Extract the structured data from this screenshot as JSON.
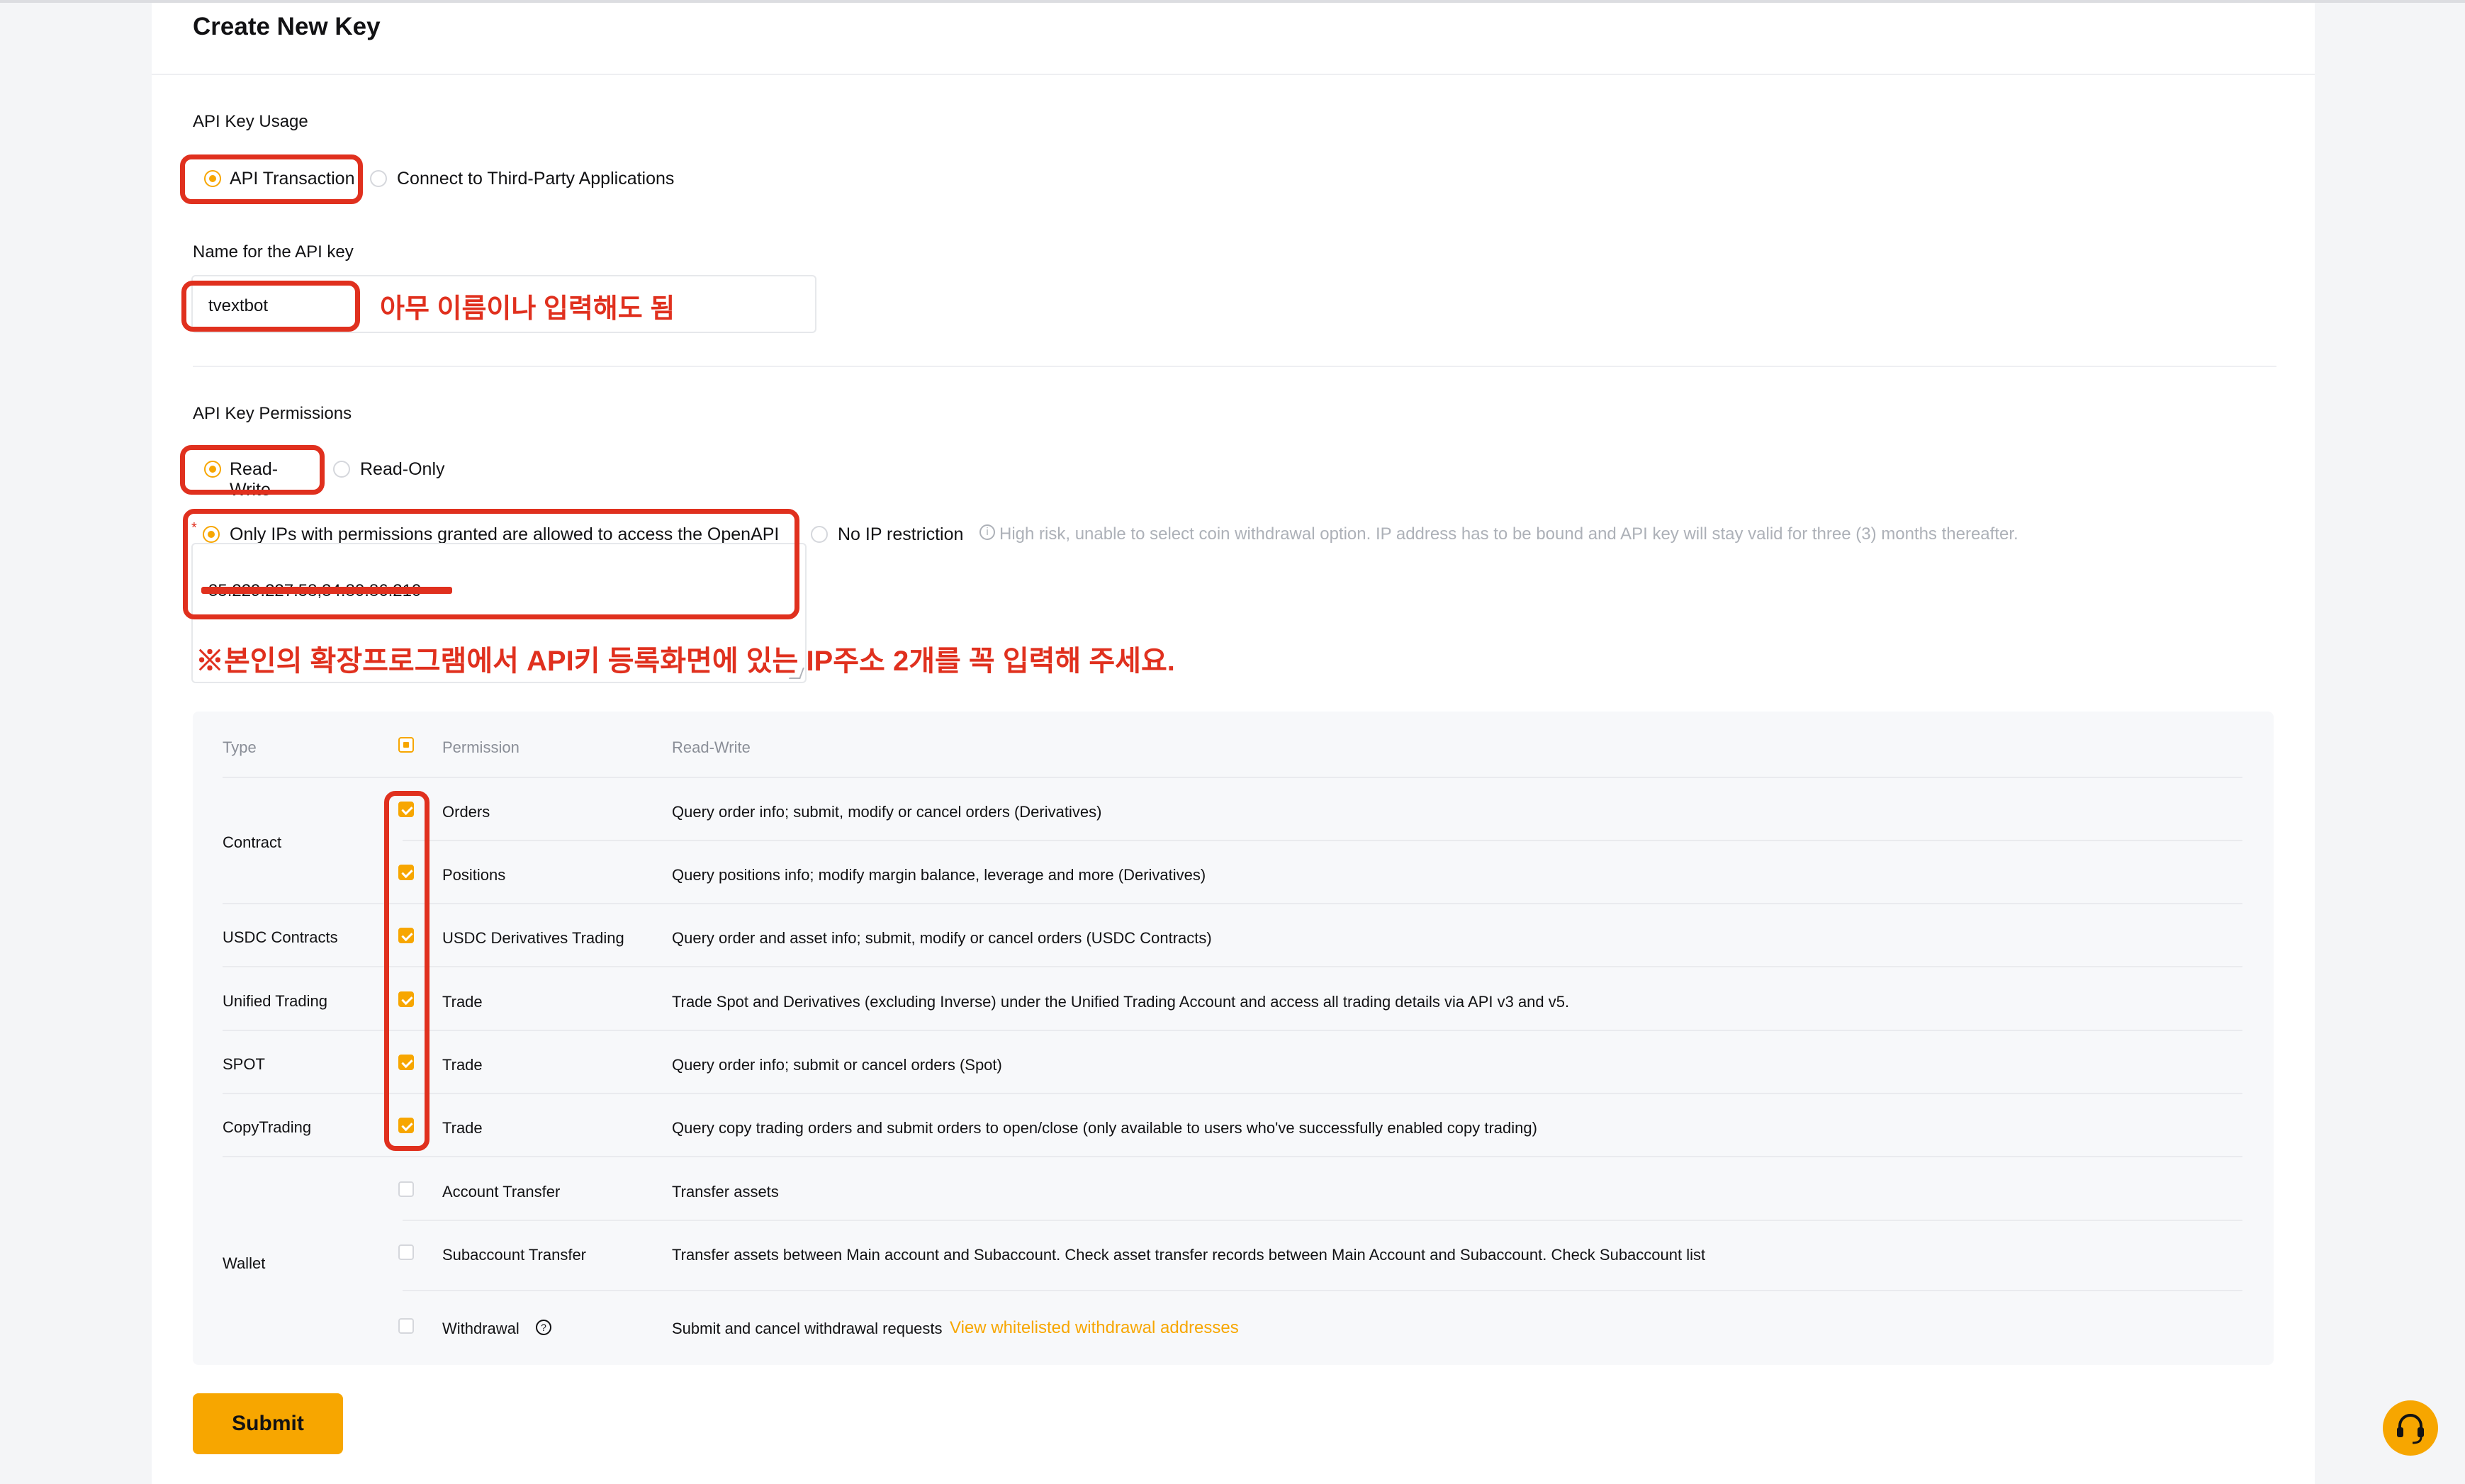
{
  "page": {
    "title": "Create New Key"
  },
  "usage": {
    "label": "API Key Usage",
    "options": [
      "API Transaction",
      "Connect to Third-Party Applications"
    ],
    "selected": "API Transaction"
  },
  "name_field": {
    "label": "Name for the API key",
    "value": "tvextbot"
  },
  "permissions": {
    "label": "API Key Permissions",
    "options": [
      "Read-Write",
      "Read-Only"
    ],
    "selected": "Read-Write"
  },
  "ip": {
    "option_restricted": "Only IPs with permissions granted are allowed to access the OpenAPI",
    "option_unrestricted": "No IP restriction",
    "warning": "High risk, unable to select coin withdrawal option. IP address has to be bound and API key will stay valid for three (3) months thereafter.",
    "value": "35.229.227.58,34.80.86.210",
    "selected": "restricted"
  },
  "annotations": {
    "name_note": "아무 이름이나 입력해도 됨",
    "ip_note": "※본인의 확장프로그램에서 API키 등록화면에 있는 IP주소 2개를 꼭 입력해 주세요."
  },
  "table": {
    "headers": {
      "type": "Type",
      "permission": "Permission",
      "access": "Read-Write"
    },
    "groups": [
      "Contract",
      "USDC Contracts",
      "Unified Trading",
      "SPOT",
      "CopyTrading",
      "Wallet"
    ],
    "rows": [
      {
        "permission": "Orders",
        "description": "Query order info; submit, modify or cancel orders (Derivatives)",
        "checked": true
      },
      {
        "permission": "Positions",
        "description": "Query positions info; modify margin balance, leverage and more (Derivatives)",
        "checked": true
      },
      {
        "permission": "USDC Derivatives Trading",
        "description": "Query order and asset info; submit, modify or cancel orders (USDC Contracts)",
        "checked": true
      },
      {
        "permission": "Trade",
        "description": "Trade Spot and Derivatives (excluding Inverse) under the Unified Trading Account and access all trading details via API v3 and v5.",
        "checked": true
      },
      {
        "permission": "Trade",
        "description": "Query order info; submit or cancel orders (Spot)",
        "checked": true
      },
      {
        "permission": "Trade",
        "description": "Query copy trading orders and submit orders to open/close (only available to users who've successfully enabled copy trading)",
        "checked": true
      },
      {
        "permission": "Account Transfer",
        "description": "Transfer assets",
        "checked": false
      },
      {
        "permission": "Subaccount Transfer",
        "description": "Transfer assets between Main account and Subaccount. Check asset transfer records between Main Account and Subaccount. Check Subaccount list",
        "checked": false
      },
      {
        "permission": "Withdrawal",
        "description": "Submit and cancel withdrawal requests",
        "checked": false
      }
    ],
    "withdrawal_link": "View whitelisted withdrawal addresses"
  },
  "actions": {
    "submit_label": "Submit"
  },
  "colors": {
    "accent": "#f7a600",
    "annotation_red": "#e0301e"
  },
  "icons": {
    "support": "headset-icon",
    "help": "question-circle-icon",
    "info": "info-circle-icon"
  }
}
